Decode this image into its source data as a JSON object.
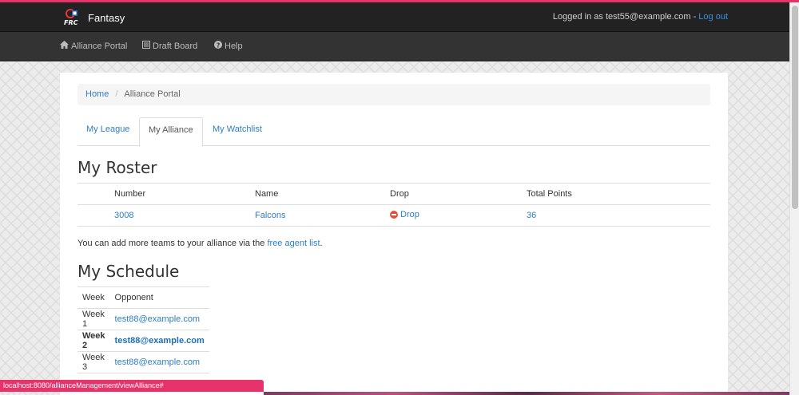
{
  "brand": {
    "logo_text": "FRC",
    "name": "Fantasy"
  },
  "header": {
    "logged_in_prefix": "Logged in as test55@example.com - ",
    "logout_label": "Log out"
  },
  "nav": {
    "items": [
      {
        "label": "Alliance Portal",
        "icon": "home-icon"
      },
      {
        "label": "Draft Board",
        "icon": "list-icon"
      },
      {
        "label": "Help",
        "icon": "question-icon"
      }
    ]
  },
  "breadcrumb": {
    "home": "Home",
    "separator": "/",
    "current": "Alliance Portal"
  },
  "tabs": [
    {
      "label": "My League",
      "active": false
    },
    {
      "label": "My Alliance",
      "active": true
    },
    {
      "label": "My Watchlist",
      "active": false
    }
  ],
  "roster": {
    "title": "My Roster",
    "columns": [
      "Number",
      "Name",
      "Drop",
      "Total Points"
    ],
    "rows": [
      {
        "number": "3008",
        "name": "Falcons",
        "drop": " Drop",
        "points": "36"
      }
    ]
  },
  "note": {
    "prefix": "You can add more teams to your alliance via the ",
    "link": "free agent list",
    "suffix": "."
  },
  "schedule": {
    "title": "My Schedule",
    "columns": [
      "Week",
      "Opponent"
    ],
    "rows": [
      {
        "week": "Week 1",
        "opponent": "test88@example.com",
        "current": false
      },
      {
        "week": "Week 2",
        "opponent": "test88@example.com",
        "current": true
      },
      {
        "week": "Week 3",
        "opponent": "test88@example.com",
        "current": false
      }
    ]
  },
  "status_bar": {
    "url": "localhost:8080/allianceManagement/viewAlliance#"
  },
  "colors": {
    "accent": "#e6336b",
    "link": "#2d7ec6",
    "navbar": "#222222",
    "subnav": "#333333"
  }
}
